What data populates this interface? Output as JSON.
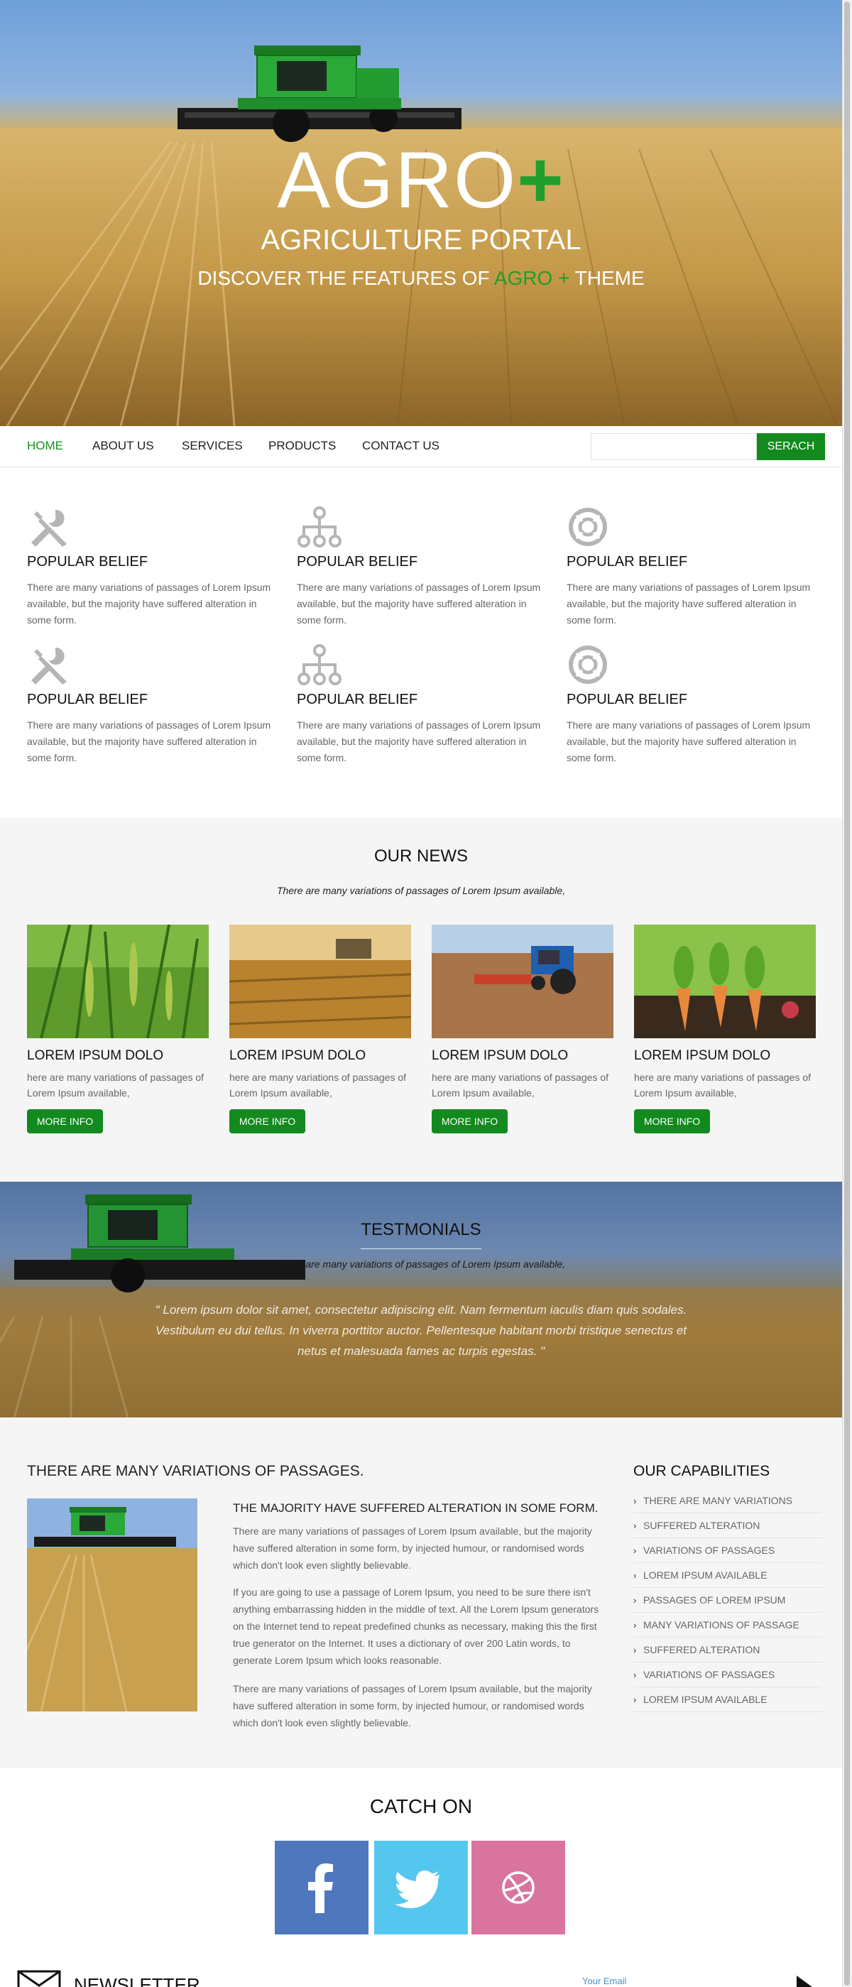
{
  "hero": {
    "title_main": "AGRO",
    "title_plus": "+",
    "subtitle": "AGRICULTURE PORTAL",
    "tagline_before": "DISCOVER THE FEATURES OF ",
    "tagline_accent": "AGRO +",
    "tagline_after": " THEME"
  },
  "nav": {
    "items": [
      {
        "label": "HOME"
      },
      {
        "label": "ABOUT US"
      },
      {
        "label": "SERVICES"
      },
      {
        "label": "PRODUCTS"
      },
      {
        "label": "CONTACT US"
      }
    ],
    "search_placeholder": "",
    "search_button": "SERACH"
  },
  "features": [
    {
      "icon": "tools-icon",
      "title": "POPULAR BELIEF",
      "text": "There are many variations of passages of Lorem Ipsum available, but the majority have suffered alteration in some form."
    },
    {
      "icon": "sitemap-icon",
      "title": "POPULAR BELIEF",
      "text": "There are many variations of passages of Lorem Ipsum available, but the majority have suffered alteration in some form."
    },
    {
      "icon": "lifebuoy-icon",
      "title": "POPULAR BELIEF",
      "text": "There are many variations of passages of Lorem Ipsum available, but the majority have suffered alteration in some form."
    },
    {
      "icon": "tools-icon",
      "title": "POPULAR BELIEF",
      "text": "There are many variations of passages of Lorem Ipsum available, but the majority have suffered alteration in some form."
    },
    {
      "icon": "sitemap-icon",
      "title": "POPULAR BELIEF",
      "text": "There are many variations of passages of Lorem Ipsum available, but the majority have suffered alteration in some form."
    },
    {
      "icon": "lifebuoy-icon",
      "title": "POPULAR BELIEF",
      "text": "There are many variations of passages of Lorem Ipsum available, but the majority have suffered alteration in some form."
    }
  ],
  "news": {
    "title": "OUR NEWS",
    "subtitle": "There are many variations of passages of Lorem Ipsum available,",
    "cards": [
      {
        "title": "LOREM IPSUM DOLO",
        "text": "here are many variations of passages of Lorem Ipsum available,",
        "button": "MORE INFO"
      },
      {
        "title": "LOREM IPSUM DOLO",
        "text": "here are many variations of passages of Lorem Ipsum available,",
        "button": "MORE INFO"
      },
      {
        "title": "LOREM IPSUM DOLO",
        "text": "here are many variations of passages of Lorem Ipsum available,",
        "button": "MORE INFO"
      },
      {
        "title": "LOREM IPSUM DOLO",
        "text": "here are many variations of passages of Lorem Ipsum available,",
        "button": "MORE INFO"
      }
    ]
  },
  "testimonials": {
    "title": "TESTMONIALS",
    "subtitle": "There are many variations of passages of Lorem Ipsum available,",
    "quote": "\" Lorem ipsum dolor sit amet, consectetur adipiscing elit. Nam fermentum iaculis diam quis sodales. Vestibulum eu dui tellus. In viverra porttitor auctor. Pellentesque habitant morbi tristique senectus et netus et malesuada fames ac turpis egestas. \""
  },
  "about": {
    "heading": "THERE ARE MANY VARIATIONS OF PASSAGES.",
    "subheading": "THE MAJORITY HAVE SUFFERED ALTERATION IN SOME FORM.",
    "paragraphs": [
      "There are many variations of passages of Lorem Ipsum available, but the majority have suffered alteration in some form, by injected humour, or randomised words which don't look even slightly believable.",
      "If you are going to use a passage of Lorem Ipsum, you need to be sure there isn't anything embarrassing hidden in the middle of text. All the Lorem Ipsum generators on the Internet tend to repeat predefined chunks as necessary, making this the first true generator on the Internet. It uses a dictionary of over 200 Latin words, to generate Lorem Ipsum which looks reasonable.",
      "There are many variations of passages of Lorem Ipsum available, but the majority have suffered alteration in some form, by injected humour, or randomised words which don't look even slightly believable."
    ]
  },
  "capabilities": {
    "title": "OUR CAPABILITIES",
    "items": [
      "THERE ARE MANY VARIATIONS",
      "SUFFERED ALTERATION",
      "VARIATIONS OF PASSAGES",
      "LOREM IPSUM AVAILABLE",
      "PASSAGES OF LOREM IPSUM",
      "MANY VARIATIONS OF PASSAGE",
      "SUFFERED ALTERATION",
      "VARIATIONS OF PASSAGES",
      "LOREM IPSUM AVAILABLE"
    ]
  },
  "catch_on": {
    "title": "CATCH ON",
    "networks": [
      {
        "icon": "facebook-icon",
        "color": "#4e77be"
      },
      {
        "icon": "twitter-icon",
        "color": "#55c7ef"
      },
      {
        "icon": "dribbble-icon",
        "color": "#d9749f"
      }
    ]
  },
  "newsletter": {
    "title": "NEWSLETTER",
    "placeholder": "Your Email"
  },
  "colors": {
    "brand_green": "#128a1e",
    "accent_green": "#1f9e2c",
    "section_gray": "#f5f5f5"
  }
}
